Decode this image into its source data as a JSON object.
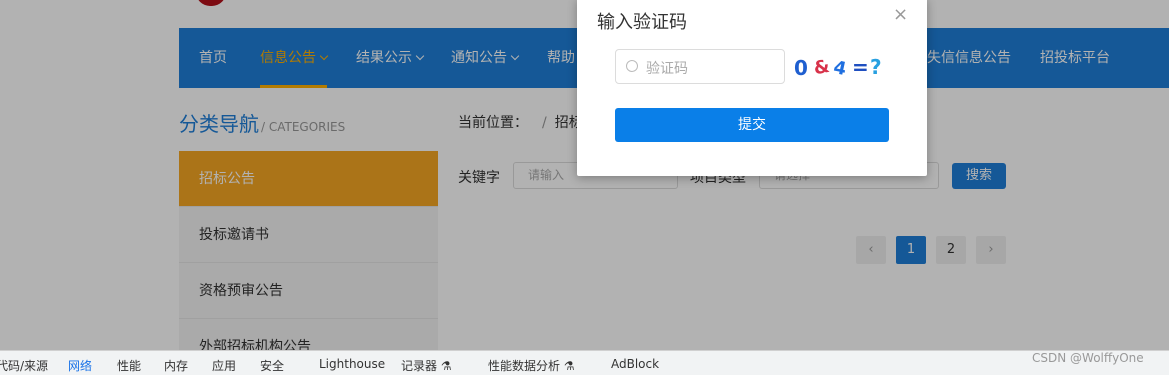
{
  "nav": {
    "items": [
      {
        "label": "首页",
        "has_dropdown": false
      },
      {
        "label": "信息公告",
        "has_dropdown": true
      },
      {
        "label": "结果公示",
        "has_dropdown": true
      },
      {
        "label": "通知公告",
        "has_dropdown": true
      },
      {
        "label": "帮助",
        "has_dropdown": false
      },
      {
        "label": "失信信息公告",
        "has_dropdown": false
      },
      {
        "label": "招投标平台",
        "has_dropdown": false
      }
    ]
  },
  "sidebar": {
    "title": "分类导航",
    "title_en": "/ CATEGORIES",
    "items": [
      {
        "label": "招标公告"
      },
      {
        "label": "投标邀请书"
      },
      {
        "label": "资格预审公告"
      },
      {
        "label": "外部招标机构公告"
      }
    ]
  },
  "breadcrumb": {
    "label": "当前位置：",
    "separator": "/",
    "current": "招标"
  },
  "filter": {
    "keyword_label": "关键字",
    "keyword_placeholder": "请输入",
    "type_label": "项目类型",
    "type_placeholder": "请选择",
    "search_label": "搜索"
  },
  "pager": {
    "prev": "‹",
    "pages": [
      "1",
      "2"
    ],
    "current": "1",
    "next": "›"
  },
  "modal": {
    "title": "输入验证码",
    "close": "×",
    "captcha_placeholder": "验证码",
    "captcha_glyphs": [
      "0",
      "&",
      "4",
      "=",
      "?"
    ],
    "submit_label": "提交"
  },
  "devtools": {
    "tabs": [
      "代码/来源",
      "网络",
      "性能",
      "内存",
      "应用",
      "安全",
      "Lighthouse",
      "记录器 ⚗",
      "性能数据分析 ⚗",
      "AdBlock"
    ],
    "active_tab": "网络"
  },
  "watermark": "CSDN @WolffyOne",
  "colors": {
    "primary": "#1f7fd8",
    "accent": "#f5a623",
    "submit": "#0a7fe8"
  }
}
